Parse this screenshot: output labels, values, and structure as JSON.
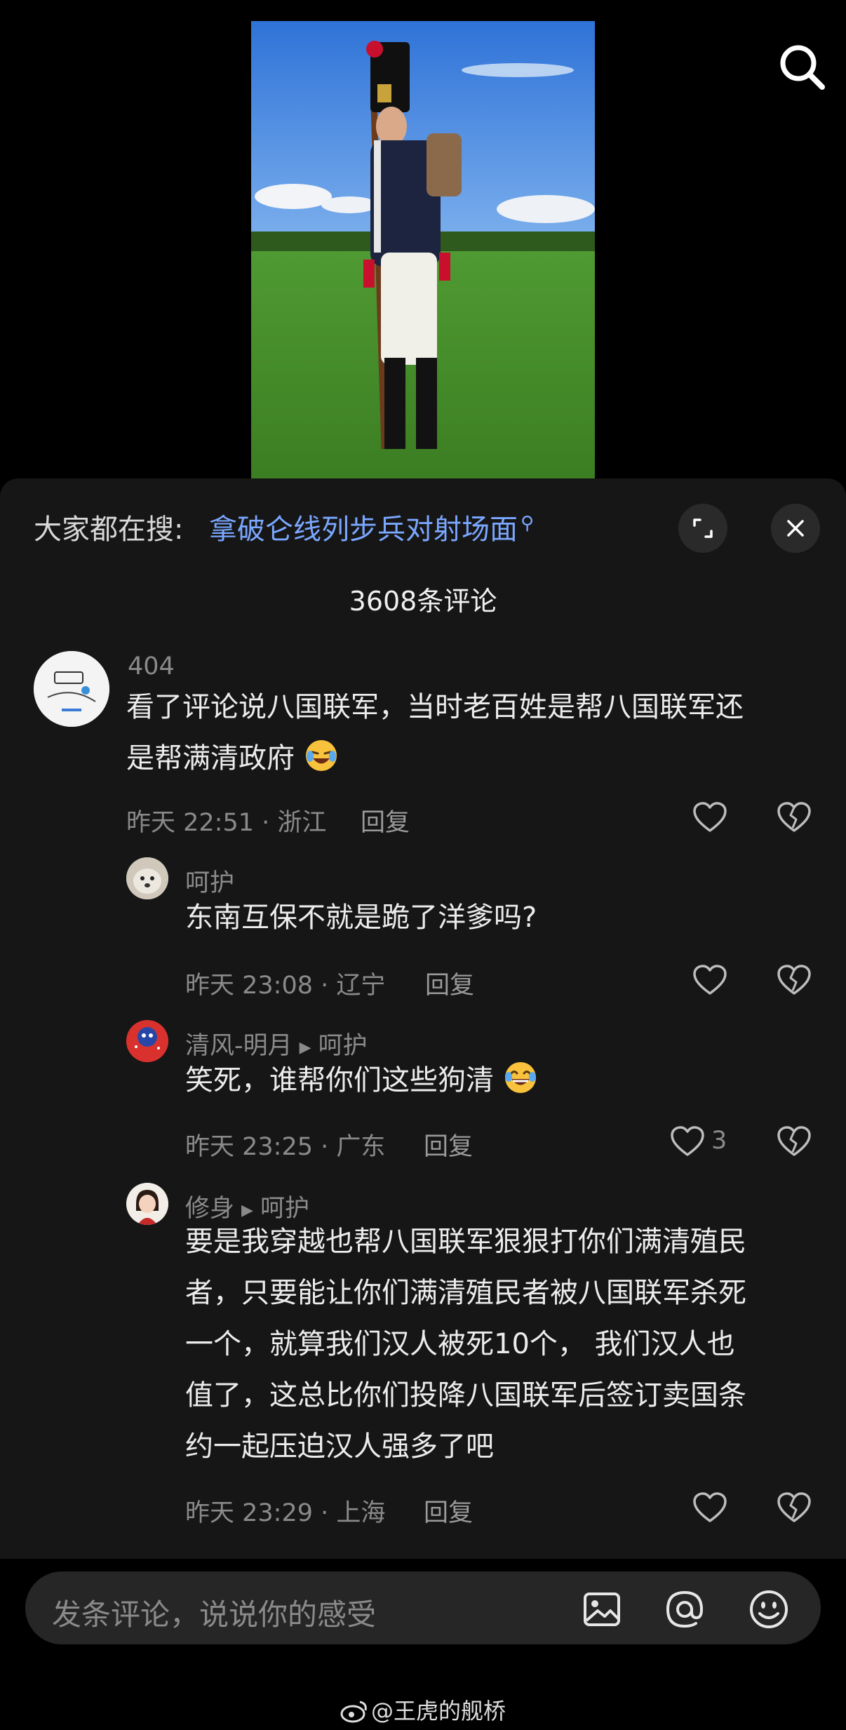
{
  "trending": {
    "label": "大家都在搜:",
    "query": "拿破仑线列步兵对射场面"
  },
  "comment_count_text": "3608条评论",
  "comments": [
    {
      "user": "404",
      "text_lines": [
        "看了评论说八国联军，当时老百姓是帮八国联军还",
        "是帮满清政府"
      ],
      "emoji": "laughing-crying",
      "time": "昨天 22:51",
      "location": "浙江",
      "reply_label": "回复",
      "likes": ""
    },
    {
      "user": "呵护",
      "text_lines": [
        "东南互保不就是跪了洋爹吗?"
      ],
      "time": "昨天 23:08",
      "location": "辽宁",
      "reply_label": "回复",
      "likes": ""
    },
    {
      "user": "清风-明月",
      "reply_to": "呵护",
      "text_lines": [
        "笑死，谁帮你们这些狗清"
      ],
      "emoji": "tears-of-joy",
      "time": "昨天 23:25",
      "location": "广东",
      "reply_label": "回复",
      "likes": "3"
    },
    {
      "user": "修身",
      "reply_to": "呵护",
      "text_lines": [
        "要是我穿越也帮八国联军狠狠打你们满清殖民",
        "者，只要能让你们满清殖民者被八国联军杀死",
        "一个，就算我们汉人被死10个， 我们汉人也",
        "值了，这总比你们投降八国联军后签订卖国条",
        "约一起压迫汉人强多了吧"
      ],
      "time": "昨天 23:29",
      "location": "上海",
      "reply_label": "回复",
      "likes": ""
    }
  ],
  "input": {
    "placeholder": "发条评论，说说你的感受"
  },
  "watermark": "@王虎的舰桥",
  "icons": {
    "search": "search-icon",
    "expand": "expand-icon",
    "close": "close-icon",
    "like": "heart-icon",
    "dislike": "broken-heart-icon",
    "image": "image-icon",
    "mention": "at-icon",
    "emoji": "emoji-icon"
  },
  "colors": {
    "link": "#7aa7ff",
    "panel": "#161616",
    "muted": "#8a8a8a"
  }
}
